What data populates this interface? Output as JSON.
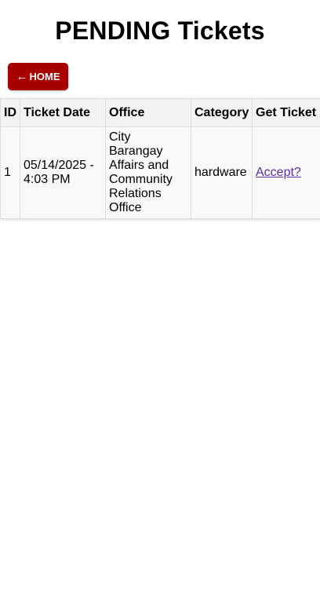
{
  "page": {
    "title": "PENDING Tickets"
  },
  "nav": {
    "home_arrow": "←",
    "home_label": "HOME"
  },
  "table": {
    "headers": {
      "id": "ID",
      "ticket_date": "Ticket Date",
      "office": "Office",
      "category": "Category",
      "get_ticket": "Get Ticket"
    },
    "rows": [
      {
        "id": "1",
        "ticket_date": "05/14/2025 - 4:03 PM",
        "office": "City Barangay Affairs and Community Relations Office",
        "category": "hardware",
        "action": "Accept?"
      }
    ]
  },
  "colors": {
    "home_button_bg": "#a80000",
    "link": "#5a2aa8",
    "header_bg": "#f2f2f2",
    "row_bg": "#f9f9f9"
  }
}
